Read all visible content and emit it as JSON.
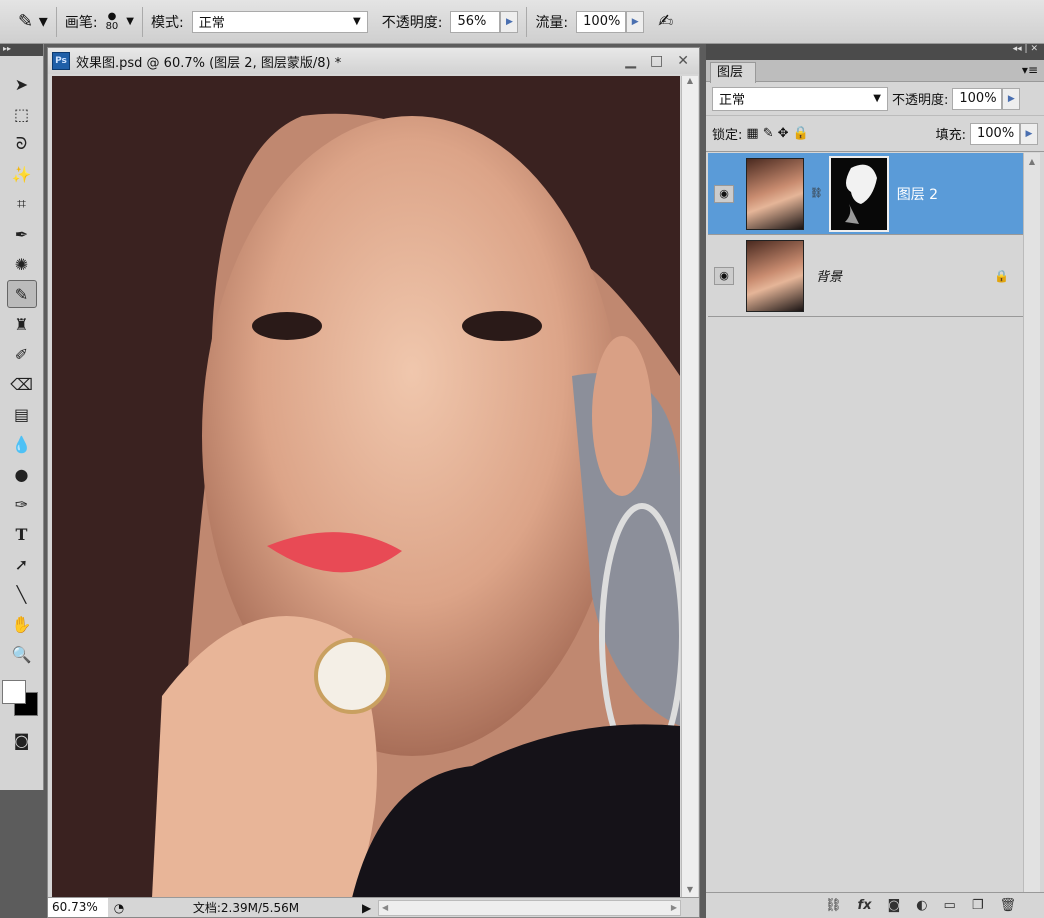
{
  "options_bar": {
    "brush_label": "画笔:",
    "brush_size": "80",
    "mode_label": "模式:",
    "mode_value": "正常",
    "opacity_label": "不透明度:",
    "opacity_value": "56%",
    "flow_label": "流量:",
    "flow_value": "100%"
  },
  "document": {
    "title": "效果图.psd @ 60.7% (图层 2, 图层蒙版/8) *",
    "zoom": "60.73%",
    "doc_info": "文档:2.39M/5.56M"
  },
  "layers_panel": {
    "tab": "图层",
    "blend_mode": "正常",
    "opacity_label": "不透明度:",
    "opacity_value": "100%",
    "lock_label": "锁定:",
    "fill_label": "填充:",
    "fill_value": "100%",
    "layers": [
      {
        "name": "图层 2",
        "selected": true,
        "has_mask": true
      },
      {
        "name": "背景",
        "selected": false,
        "locked": true
      }
    ]
  },
  "colors": {
    "selection": "#5a9bd8",
    "panel_bg": "#d6d6d6"
  }
}
